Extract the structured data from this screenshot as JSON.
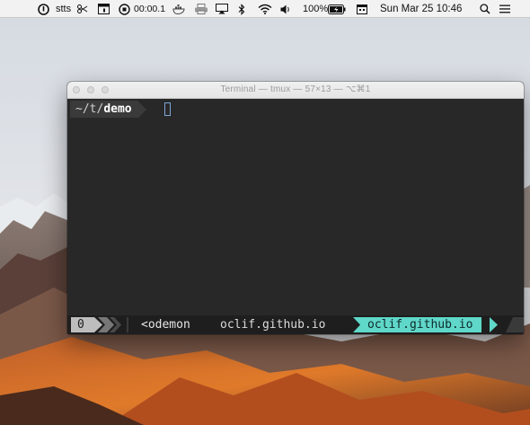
{
  "menubar": {
    "app_label": "stts",
    "timer": "00:00.1",
    "battery": "100%",
    "datetime": "Sun Mar 25  10:46"
  },
  "terminal": {
    "title": "Terminal — tmux — 57×13 — ⌥⌘1",
    "prompt_path": "~/t/",
    "prompt_dir": "demo"
  },
  "tmux": {
    "session_index": "0",
    "window_label": "<odemon",
    "host_label": "oclif.github.io",
    "active_label": "oclif.github.io"
  },
  "colors": {
    "status_active": "#5fd7c9",
    "terminal_bg": "#282828"
  }
}
